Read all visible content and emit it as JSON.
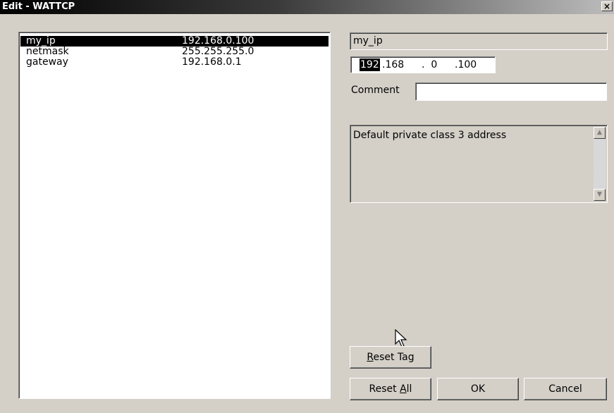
{
  "window": {
    "title": "Edit - WATTCP",
    "close_glyph": "×"
  },
  "tags": [
    {
      "name": "my_ip",
      "value": "192.168.0.100",
      "selected": true
    },
    {
      "name": "netmask",
      "value": "255.255.255.0",
      "selected": false
    },
    {
      "name": "gateway",
      "value": "192.168.0.1",
      "selected": false
    }
  ],
  "editor": {
    "tag_name": "my_ip",
    "ip": {
      "o1": "192",
      "o2": ".168",
      "o3": ".  0",
      "o4": ".100"
    },
    "comment_label": "Comment",
    "comment_value": "",
    "description": "Default private class 3 address"
  },
  "buttons": {
    "reset_tag_pre": "",
    "reset_tag_key": "R",
    "reset_tag_post": "eset Tag",
    "reset_all_pre": "Reset ",
    "reset_all_key": "A",
    "reset_all_post": "ll",
    "ok": "OK",
    "cancel": "Cancel"
  },
  "icons": {
    "scroll_up": "▲",
    "scroll_down": "▼"
  }
}
